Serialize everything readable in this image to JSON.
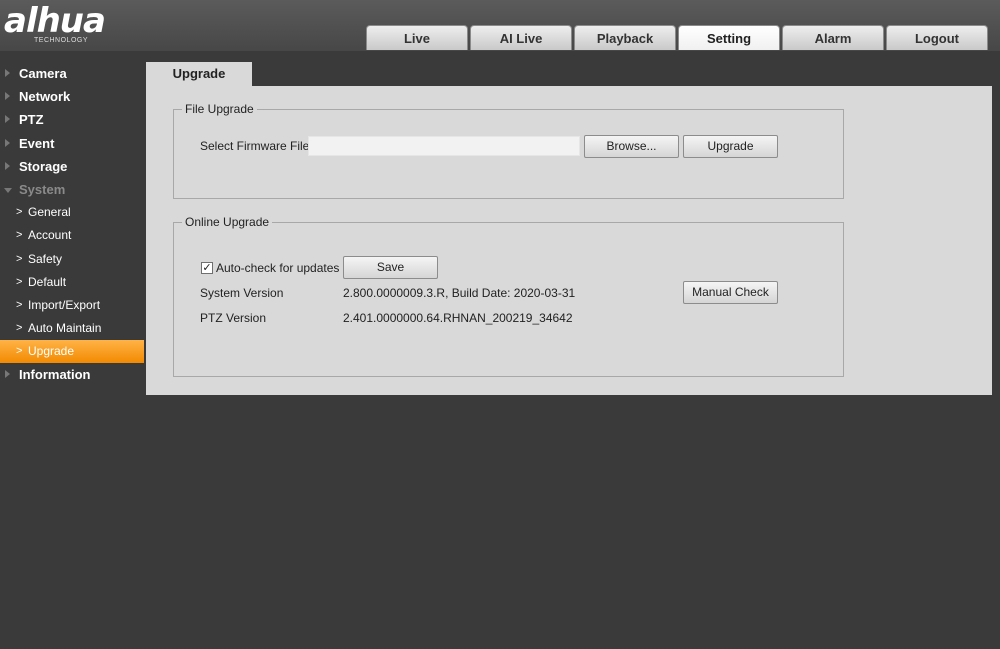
{
  "header": {
    "logo_text": "alhua",
    "logo_sub": "TECHNOLOGY",
    "tabs": [
      {
        "label": "Live"
      },
      {
        "label": "AI Live"
      },
      {
        "label": "Playback"
      },
      {
        "label": "Setting",
        "active": true
      },
      {
        "label": "Alarm"
      },
      {
        "label": "Logout"
      }
    ]
  },
  "sidebar": {
    "items": [
      {
        "label": "Camera"
      },
      {
        "label": "Network"
      },
      {
        "label": "PTZ"
      },
      {
        "label": "Event"
      },
      {
        "label": "Storage"
      },
      {
        "label": "System",
        "expanded": true,
        "children": [
          {
            "label": "General"
          },
          {
            "label": "Account"
          },
          {
            "label": "Safety"
          },
          {
            "label": "Default"
          },
          {
            "label": "Import/Export"
          },
          {
            "label": "Auto Maintain"
          },
          {
            "label": "Upgrade",
            "active": true
          }
        ]
      },
      {
        "label": "Information"
      }
    ]
  },
  "page": {
    "tab_label": "Upgrade",
    "file_upgrade": {
      "legend": "File Upgrade",
      "select_label": "Select Firmware File",
      "file_value": "",
      "browse_label": "Browse...",
      "upgrade_label": "Upgrade"
    },
    "online_upgrade": {
      "legend": "Online Upgrade",
      "auto_check_label": "Auto-check for updates",
      "auto_check_checked": true,
      "save_label": "Save",
      "system_version_label": "System Version",
      "system_version_value": "2.800.0000009.3.R, Build Date: 2020-03-31",
      "ptz_version_label": "PTZ Version",
      "ptz_version_value": "2.401.0000000.64.RHNAN_200219_34642",
      "manual_check_label": "Manual Check"
    }
  },
  "colors": {
    "accent": "#f28a00",
    "background": "#3a3a3a",
    "panel": "#d9d9d9"
  },
  "icons": {
    "collapsed_arrow": "triangle-right-icon",
    "expanded_arrow": "triangle-down-icon",
    "sub_chevron": "chevron-right-icon",
    "check": "checkmark-icon"
  }
}
